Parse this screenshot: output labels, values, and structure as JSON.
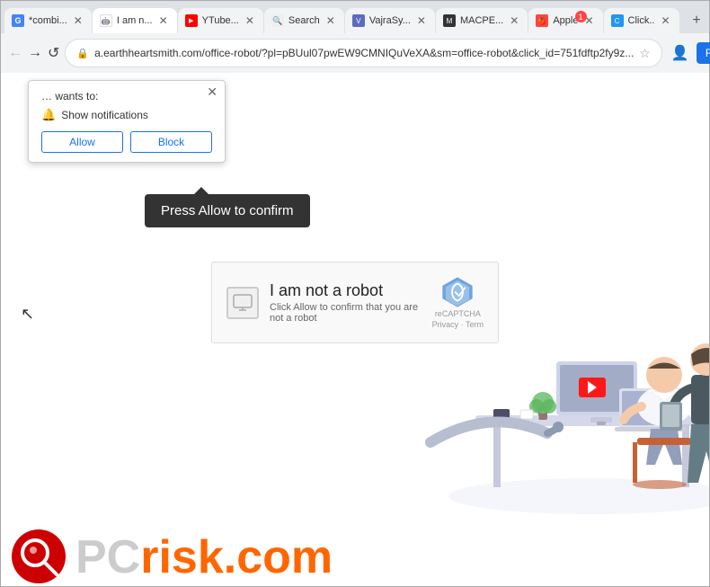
{
  "browser": {
    "tabs": [
      {
        "id": "tab1",
        "label": "*combi...",
        "favicon": "G",
        "active": false
      },
      {
        "id": "tab2",
        "label": "I am n...",
        "favicon": "I",
        "active": true
      },
      {
        "id": "tab3",
        "label": "YTube...",
        "favicon": "Y",
        "active": false
      },
      {
        "id": "tab4",
        "label": "Search",
        "favicon": "S",
        "active": false
      },
      {
        "id": "tab5",
        "label": "VajraSy...",
        "favicon": "V",
        "active": false
      },
      {
        "id": "tab6",
        "label": "MACPE...",
        "favicon": "M",
        "active": false
      },
      {
        "id": "tab7",
        "label": "Apple",
        "favicon": "A",
        "active": false
      },
      {
        "id": "tab8",
        "label": "Click..",
        "favicon": "C",
        "active": false
      }
    ],
    "address_url": "a.earthheartsmith.com/office-robot/?pl=pBUul07pwEW9CMNIQuVeXA&sm=office-robot&click_id=751fdftp2fy9z...",
    "relaunch_label": "Relaunch to update",
    "nav_buttons": {
      "back": "←",
      "forward": "→",
      "reload": "↺"
    }
  },
  "popup": {
    "wants_text": "… wants to:",
    "notification_label": "Show notifications",
    "allow_label": "Allow",
    "block_label": "Block",
    "close_symbol": "✕"
  },
  "tooltip": {
    "text": "Press Allow to confirm"
  },
  "captcha": {
    "title": "I am not a robot",
    "subtitle": "Click Allow to confirm that you are not a robot",
    "recaptcha_brand": "reCAPTCHA",
    "recaptcha_links": "Privacy · Term"
  },
  "pcrisk": {
    "pc_text": "PC",
    "risk_text": "risk.com"
  },
  "colors": {
    "allow_blue": "#1a73e8",
    "tooltip_bg": "#333333",
    "orange": "#ff6600",
    "gray_text": "#ccc"
  }
}
